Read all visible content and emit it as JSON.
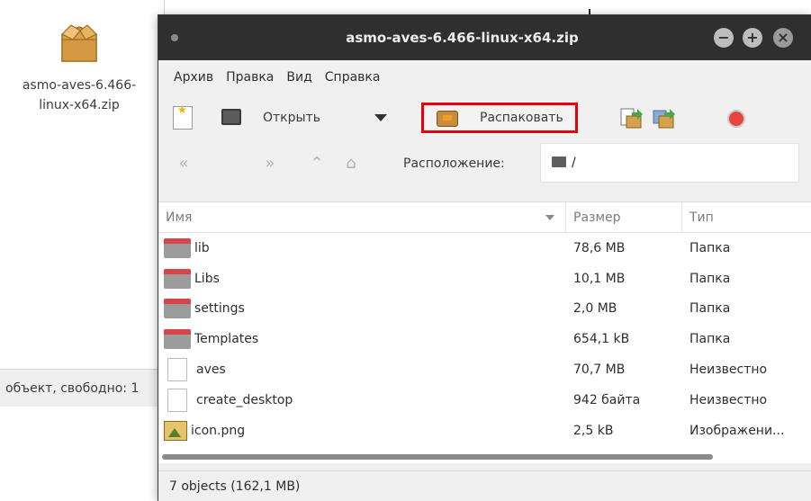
{
  "desktop": {
    "file": {
      "label": "asmo-aves-6.466-linux-x64.zip",
      "icon": "zip-archive-icon"
    },
    "status_text": "объект, свободно: 1"
  },
  "window": {
    "title": "asmo-aves-6.466-linux-x64.zip",
    "controls": {
      "minimize": "−",
      "maximize": "+",
      "close": "×"
    }
  },
  "menu": {
    "items": [
      "Архив",
      "Правка",
      "Вид",
      "Справка"
    ]
  },
  "toolbar": {
    "open_label": "Открыть",
    "extract_label": "Распаковать",
    "highlight_color": "#e8000b"
  },
  "nav": {
    "location_label": "Расположение:",
    "location_value": "/"
  },
  "columns": {
    "name": "Имя",
    "size": "Размер",
    "type": "Тип"
  },
  "rows": [
    {
      "name": "lib",
      "size": "78,6 MB",
      "type": "Папка",
      "icon": "folder-icon"
    },
    {
      "name": "Libs",
      "size": "10,1 MB",
      "type": "Папка",
      "icon": "folder-icon"
    },
    {
      "name": "settings",
      "size": "2,0 MB",
      "type": "Папка",
      "icon": "folder-icon"
    },
    {
      "name": "Templates",
      "size": "654,1 kB",
      "type": "Папка",
      "icon": "folder-icon"
    },
    {
      "name": "aves",
      "size": "70,7 MB",
      "type": "Неизвестно",
      "icon": "file-icon"
    },
    {
      "name": "create_desktop",
      "size": "942 байта",
      "type": "Неизвестно",
      "icon": "file-icon"
    },
    {
      "name": "icon.png",
      "size": "2,5 kB",
      "type": "Изображени...",
      "icon": "image-icon"
    }
  ],
  "status": {
    "text": "7 objects (162,1 MB)"
  }
}
